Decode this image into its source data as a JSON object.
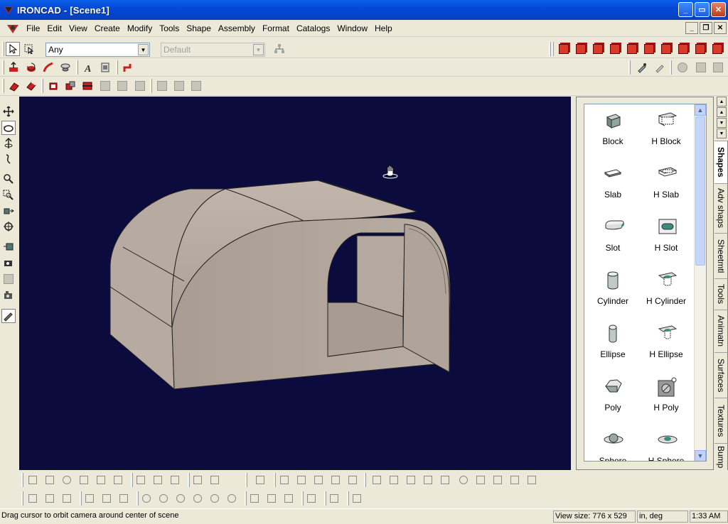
{
  "window": {
    "title": "IRONCAD - [Scene1]",
    "minimize": "_",
    "restore": "▭",
    "close": "✕"
  },
  "menu": {
    "items": [
      "File",
      "Edit",
      "View",
      "Create",
      "Modify",
      "Tools",
      "Shape",
      "Assembly",
      "Format",
      "Catalogs",
      "Window",
      "Help"
    ]
  },
  "toolbar": {
    "selection_filter_value": "Any",
    "style_value": "Default"
  },
  "catalog": {
    "items": [
      {
        "label": "Block",
        "icon": "block-icon"
      },
      {
        "label": "H Block",
        "icon": "h-block-icon"
      },
      {
        "label": "Slab",
        "icon": "slab-icon"
      },
      {
        "label": "H Slab",
        "icon": "h-slab-icon"
      },
      {
        "label": "Slot",
        "icon": "slot-icon"
      },
      {
        "label": "H Slot",
        "icon": "h-slot-icon"
      },
      {
        "label": "Cylinder",
        "icon": "cylinder-icon"
      },
      {
        "label": "H Cylinder",
        "icon": "h-cylinder-icon"
      },
      {
        "label": "Ellipse",
        "icon": "ellipse-icon"
      },
      {
        "label": "H Ellipse",
        "icon": "h-ellipse-icon"
      },
      {
        "label": "Poly",
        "icon": "poly-icon"
      },
      {
        "label": "H Poly",
        "icon": "h-poly-icon"
      },
      {
        "label": "Sphere",
        "icon": "sphere-icon"
      },
      {
        "label": "H Sphere",
        "icon": "h-sphere-icon"
      }
    ],
    "tabs": [
      "Shapes",
      "Adv shaps",
      "Sheetmtl",
      "Tools",
      "Animatn",
      "Surfaces",
      "Textures",
      "Bump"
    ]
  },
  "viewport": {
    "background": "#0b0b3e",
    "part_color": "#b3a79e",
    "cursor": "orbit-hand-icon"
  },
  "status": {
    "message": "Drag cursor to orbit camera around center of scene",
    "view_size": "View size:  776 x  529",
    "units": "in, deg",
    "time": "1:33 AM"
  }
}
